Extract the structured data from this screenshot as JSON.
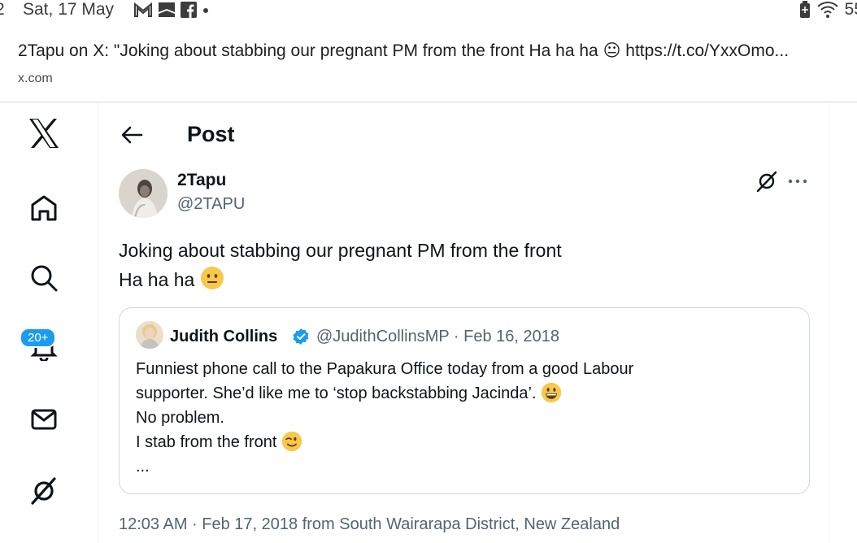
{
  "status_bar": {
    "time_fragment": "2",
    "date": "Sat, 17 May",
    "notification_icons": [
      "gmail-icon",
      "flipboard-icon",
      "facebook-icon",
      "dot-icon"
    ],
    "right_icons": [
      "battery-saver-icon",
      "wifi-icon"
    ],
    "battery_fragment": "55"
  },
  "share": {
    "title": "2Tapu on X: \"Joking about stabbing our pregnant PM from the front Ha ha ha 😐 https://t.co/YxxOmo...",
    "domain": "x.com"
  },
  "nav": {
    "items": [
      "x-logo-icon",
      "home-icon",
      "search-icon",
      "notifications-icon",
      "messages-icon",
      "grok-icon"
    ],
    "notification_badge": "20+"
  },
  "header": {
    "title": "Post"
  },
  "post": {
    "author_name": "2Tapu",
    "author_handle": "@2TAPU",
    "text_line1": "Joking about stabbing our pregnant PM from the front",
    "text_line2": "Ha ha ha",
    "text_emoji": "neutral-face",
    "timestamp": "12:03 AM · Feb 17, 2018 from South Wairarapa District, New Zealand"
  },
  "quote": {
    "author_name": "Judith Collins",
    "verified": true,
    "meta": "@JudithCollinsMP · Feb 16, 2018",
    "line1": "Funniest phone call to the Papakura Office today from a good Labour",
    "line2": "supporter. She’d like me to ‘stop backstabbing Jacinda’.",
    "line3": "No problem.",
    "line4": "I stab from the front",
    "line5": "...",
    "line2_emoji": "grinning-face",
    "line4_emoji": "winking-face"
  },
  "colors": {
    "accent": "#1d9bf0",
    "text": "#0f1419",
    "secondary": "#536471",
    "border": "#cfd9de",
    "emoji_yellow": "#f7c84a"
  }
}
